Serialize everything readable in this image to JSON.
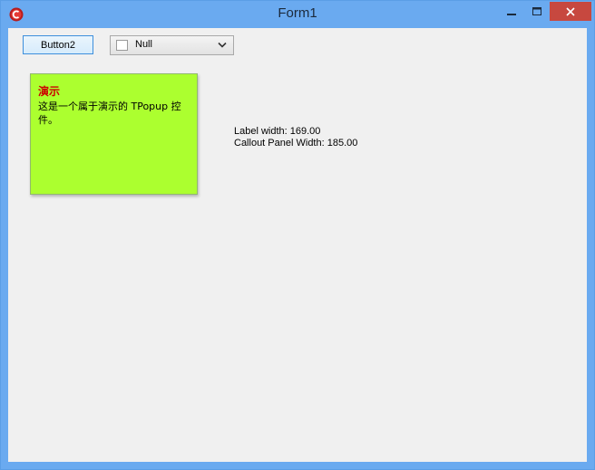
{
  "window": {
    "title": "Form1",
    "accent_color": "#6aaaf0",
    "close_color": "#c7483f"
  },
  "toolbar": {
    "button_label": "Button2",
    "combo": {
      "selected": "Null",
      "checked": false
    }
  },
  "callout": {
    "title": "演示",
    "text": "这是一个属于演示的 TPopup 控件。",
    "background": "#acff2f",
    "title_color": "#cc0000"
  },
  "info": {
    "label_width": "Label width: 169.00",
    "callout_width": "Callout Panel Width: 185.00"
  },
  "icons": [
    "app-icon",
    "minimize-icon",
    "maximize-icon",
    "close-icon",
    "chevron-down-icon"
  ]
}
